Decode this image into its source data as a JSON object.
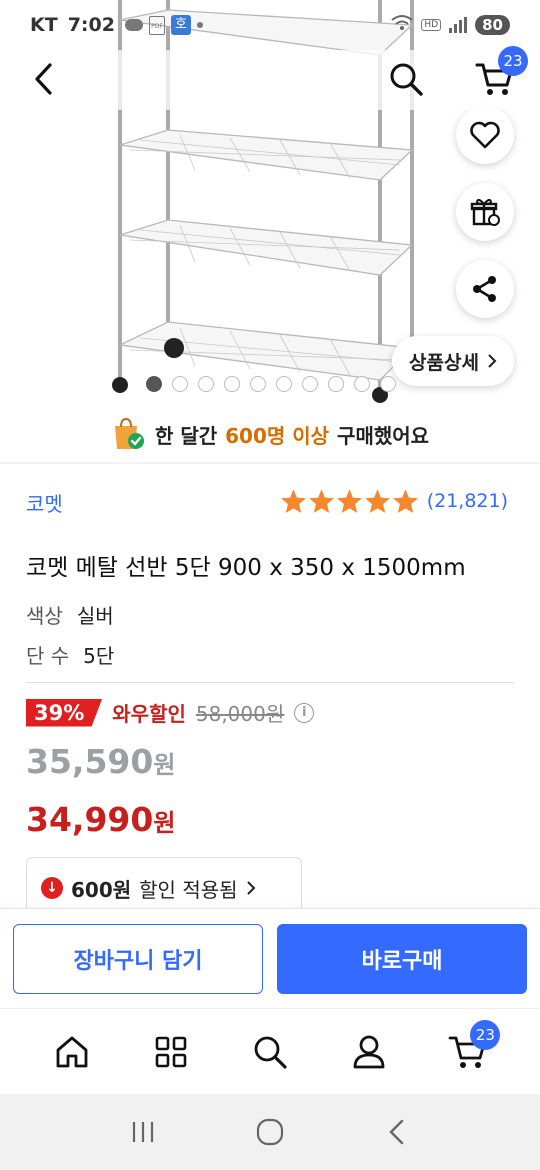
{
  "status_bar": {
    "carrier": "KT",
    "time": "7:02",
    "app_badge": "호",
    "battery": "80"
  },
  "header": {
    "cart_count": "23"
  },
  "gallery": {
    "detail_label": "상품상세",
    "image_count": 10,
    "active_index": 0
  },
  "buyers": {
    "prefix": "한 달간",
    "highlight": "600명 이상",
    "suffix": "구매했어요"
  },
  "product": {
    "brand": "코멧",
    "rating_stars": 5,
    "review_count": "(21,821)",
    "title": "코멧 메탈 선반 5단 900 x 350 x 1500mm",
    "options": [
      {
        "label": "색상",
        "value": "실버"
      },
      {
        "label": "단 수",
        "value": "5단"
      }
    ]
  },
  "pricing": {
    "discount_rate": "39%",
    "wow_label": "와우할인",
    "original_price": "58,000원",
    "sale_price_number": "35,590",
    "sale_price_unit": "원",
    "final_price_number": "34,990",
    "final_price_unit": "원",
    "coupon_amount": "600원",
    "coupon_text": "할인 적용됨"
  },
  "actions": {
    "add_to_cart": "장바구니 담기",
    "buy_now": "바로구매"
  },
  "tabbar": {
    "cart_count": "23"
  },
  "colors": {
    "accent_blue": "#346aff",
    "discount_red": "#e02020",
    "highlight_orange": "#d66d00",
    "star_orange": "#f5882d"
  }
}
